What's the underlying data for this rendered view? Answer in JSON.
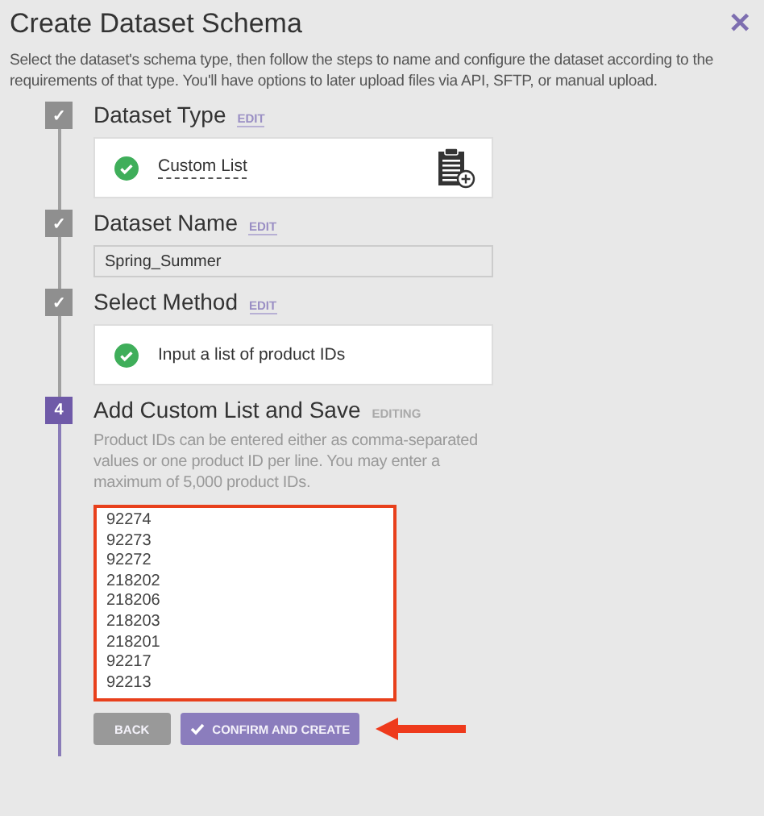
{
  "dialog": {
    "title": "Create Dataset Schema",
    "close": "✕",
    "description": "Select the dataset's schema type, then follow the steps to name and configure the dataset according to the requirements of that type. You'll have options to later upload files via API, SFTP, or manual upload."
  },
  "steps": [
    {
      "kind": "card",
      "done": true,
      "marker": "✓",
      "title": "Dataset Type",
      "action": "EDIT",
      "value": "Custom List",
      "icon": true
    },
    {
      "kind": "field",
      "done": true,
      "marker": "✓",
      "title": "Dataset Name",
      "action": "EDIT",
      "value": "Spring_Summer"
    },
    {
      "kind": "card",
      "done": true,
      "marker": "✓",
      "title": "Select Method",
      "action": "EDIT",
      "value": "Input a list of product IDs",
      "icon": false
    },
    {
      "kind": "list",
      "done": false,
      "marker": "4",
      "title": "Add Custom List and Save",
      "action": "EDITING",
      "help": "Product IDs can be entered either as comma-separated values or one product ID per line. You may enter a maximum of 5,000 product IDs.",
      "ids": [
        "92274",
        "92273",
        "92272",
        "218202",
        "218206",
        "218203",
        "218201",
        "92217",
        "92213"
      ],
      "buttons": [
        {
          "label": "BACK",
          "kind": "secondary"
        },
        {
          "label": "CONFIRM AND CREATE",
          "kind": "primary"
        }
      ]
    }
  ]
}
